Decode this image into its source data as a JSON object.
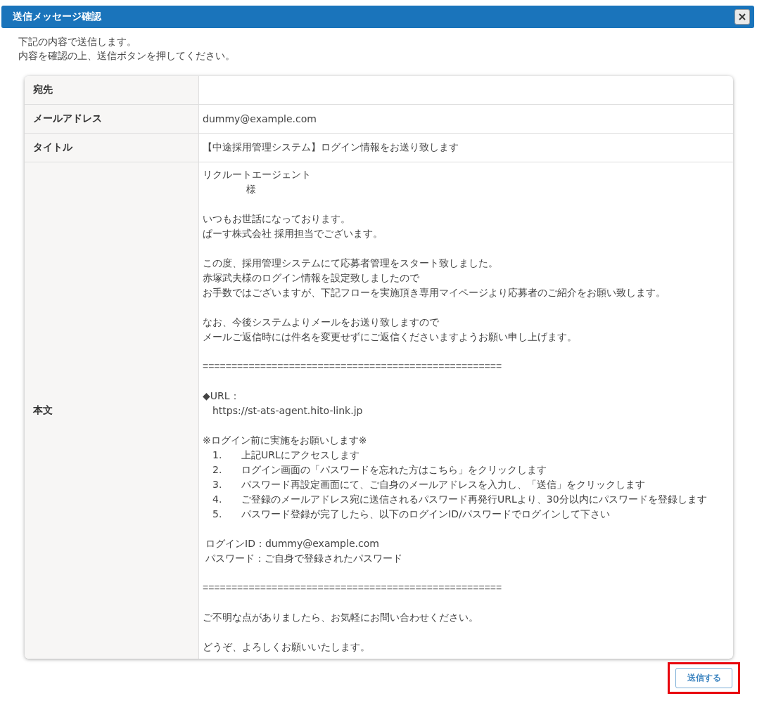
{
  "dialog": {
    "title": "送信メッセージ確認",
    "intro": [
      "下記の内容で送信します。",
      "内容を確認の上、送信ボタンを押してください。"
    ]
  },
  "table": {
    "rows": [
      {
        "kind": "field",
        "label": "宛先"
      },
      {
        "kind": "field",
        "label": "メールアドレス",
        "value": "dummy@example.com"
      },
      {
        "kind": "field",
        "label": "タイトル",
        "value": "【中途採用管理システム】ログイン情報をお送り致します"
      },
      {
        "kind": "body",
        "label": "本文",
        "blocks": [
          {
            "kind": "para",
            "lines": [
              "リクルートエージェント",
              "様"
            ]
          },
          {
            "kind": "para",
            "lines": [
              "いつもお世話になっております。",
              "ぱーす株式会社 採用担当でございます。"
            ]
          },
          {
            "kind": "para",
            "lines": [
              "この度、採用管理システムにて応募者管理をスタート致しました。",
              "赤塚武夫様のログイン情報を設定致しましたので",
              "お手数ではございますが、下記フローを実施頂き専用マイページより応募者のご紹介をお願い致します。"
            ]
          },
          {
            "kind": "para",
            "lines": [
              "なお、今後システムよりメールをお送り致しますので",
              "メールご返信時には件名を変更せずにご返信くださいますようお願い申し上げます。"
            ]
          },
          {
            "kind": "rule",
            "text": "===================================================="
          },
          {
            "kind": "url",
            "label": "◆URL：",
            "url": "https://st-ats-agent.hito-link.jp"
          },
          {
            "kind": "steps",
            "heading": "※ログイン前に実施をお願いします※",
            "items": [
              {
                "number": "1.",
                "text": "上記URLにアクセスします"
              },
              {
                "number": "2.",
                "text": "ログイン画面の「パスワードを忘れた方はこちら」をクリックします"
              },
              {
                "number": "3.",
                "text": "パスワード再設定画面にて、ご自身のメールアドレスを入力し、「送信」をクリックします"
              },
              {
                "number": "4.",
                "text": "ご登録のメールアドレス宛に送信されるパスワード再発行URLより、30分以内にパスワードを登録します"
              },
              {
                "number": "5.",
                "text": "パスワード登録が完了したら、以下のログインID/パスワードでログインして下さい"
              }
            ]
          },
          {
            "kind": "para",
            "lines": [
              "ログインID：dummy@example.com",
              "パスワード：ご自身で登録されたパスワード"
            ]
          },
          {
            "kind": "rule",
            "text": "===================================================="
          },
          {
            "kind": "para",
            "lines": [
              "ご不明な点がありましたら、お気軽にお問い合わせください。"
            ]
          },
          {
            "kind": "para",
            "lines": [
              "どうぞ、よろしくお願いいたします。"
            ]
          }
        ]
      }
    ]
  },
  "send_button": {
    "label": "送信する",
    "highlighted": true
  }
}
